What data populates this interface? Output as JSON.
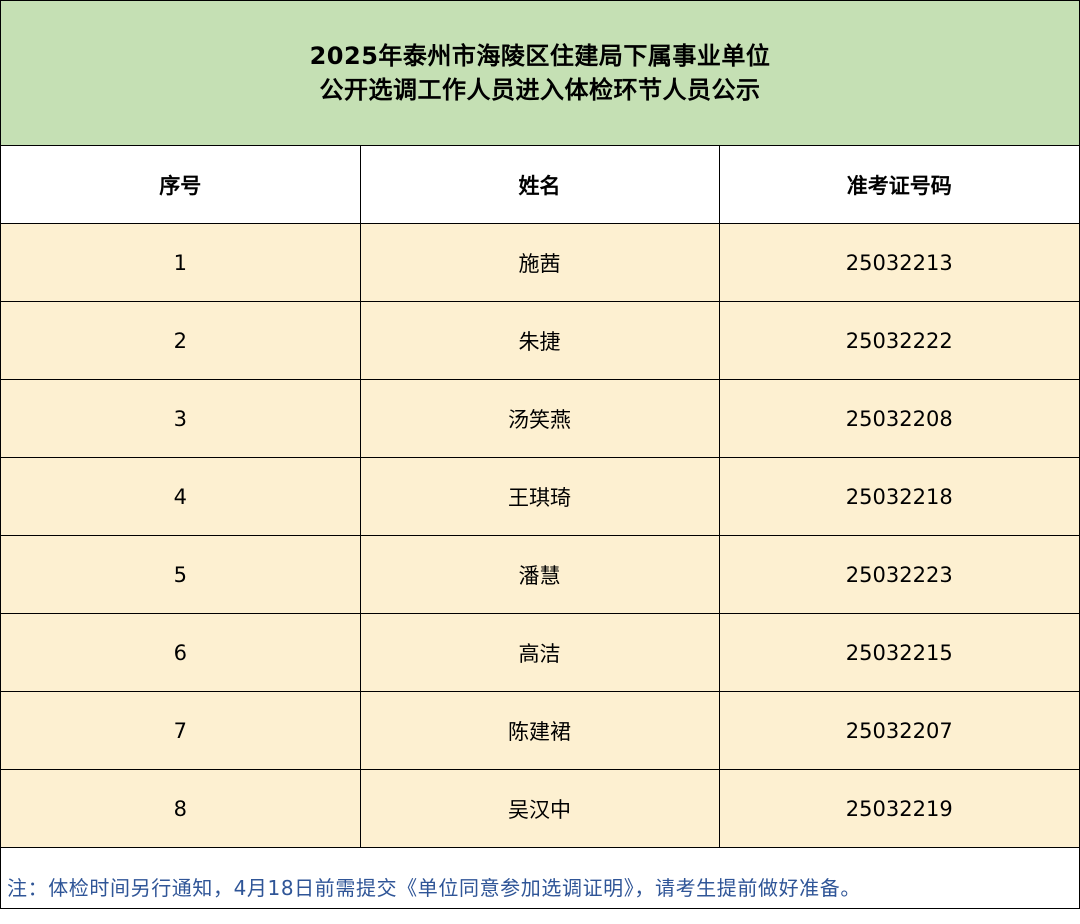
{
  "title": {
    "line1": "2025年泰州市海陵区住建局下属事业单位",
    "line2": "公开选调工作人员进入体检环节人员公示"
  },
  "table": {
    "headers": [
      "序号",
      "姓名",
      "准考证号码"
    ],
    "rows": [
      {
        "index": "1",
        "name": "施茜",
        "ticket": "25032213"
      },
      {
        "index": "2",
        "name": "朱捷",
        "ticket": "25032222"
      },
      {
        "index": "3",
        "name": "汤笑燕",
        "ticket": "25032208"
      },
      {
        "index": "4",
        "name": "王琪琦",
        "ticket": "25032218"
      },
      {
        "index": "5",
        "name": "潘慧",
        "ticket": "25032223"
      },
      {
        "index": "6",
        "name": "高洁",
        "ticket": "25032215"
      },
      {
        "index": "7",
        "name": "陈建裙",
        "ticket": "25032207"
      },
      {
        "index": "8",
        "name": "吴汉中",
        "ticket": "25032219"
      }
    ]
  },
  "note": "注：体检时间另行通知，4月18日前需提交《单位同意参加选调证明》，请考生提前做好准备。",
  "colors": {
    "title_background": "#c5e0b4",
    "row_background": "#fdf0d1",
    "note_text": "#2f5597"
  }
}
